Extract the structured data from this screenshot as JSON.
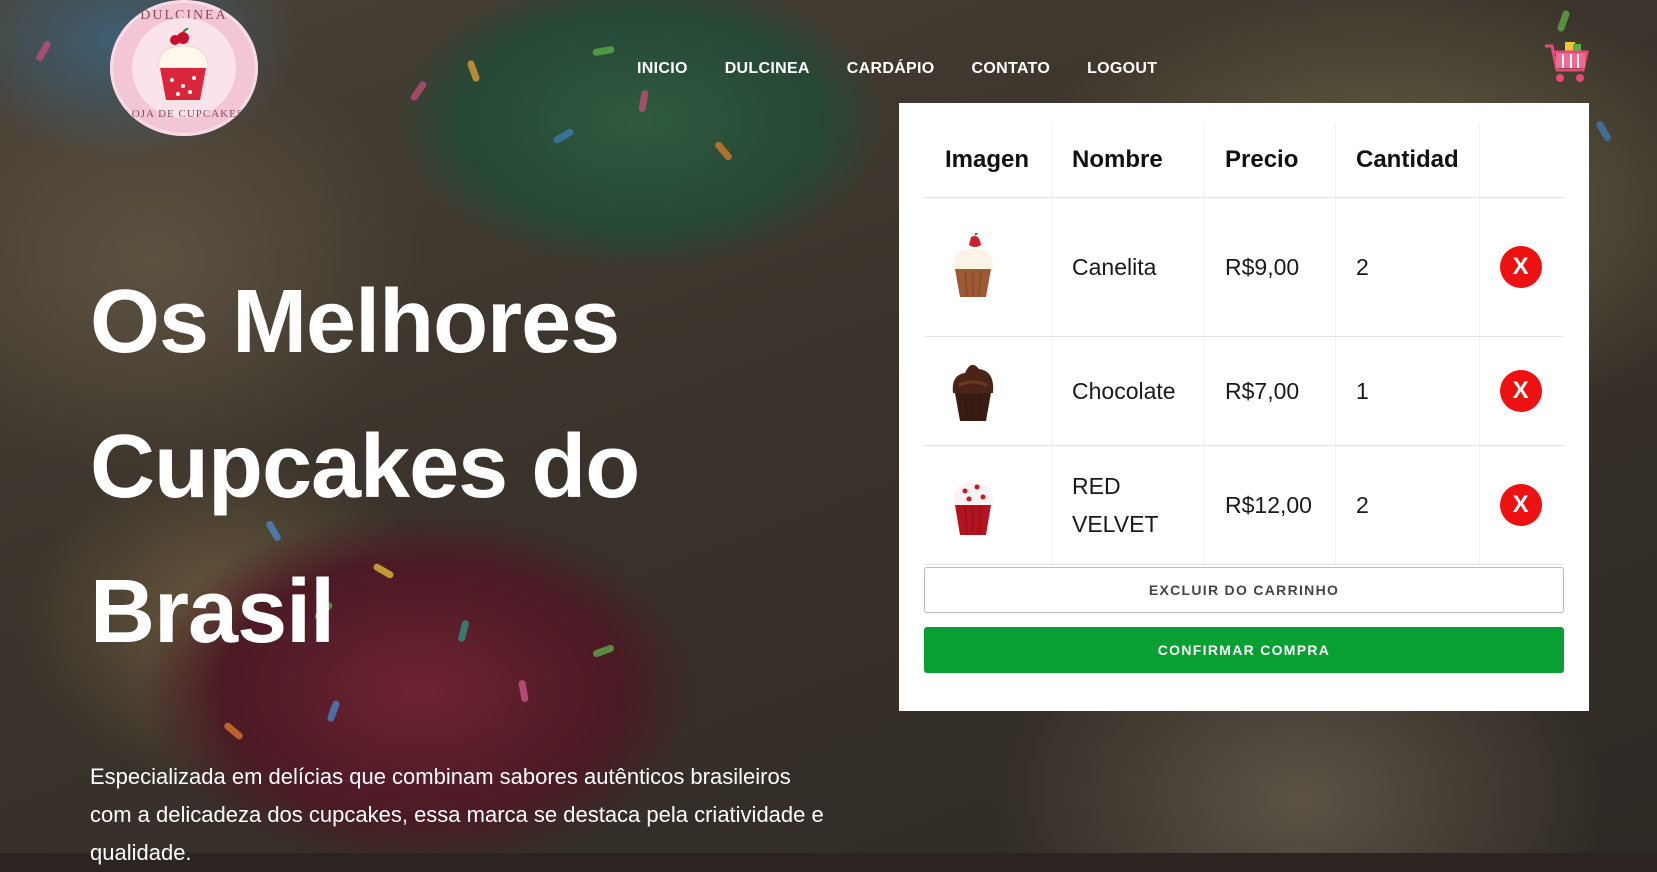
{
  "brand": {
    "logo_top_text": "DULCINEA",
    "logo_bottom_text": "LOJA DE CUPCAKES"
  },
  "nav": {
    "items": [
      {
        "label": "INICIO"
      },
      {
        "label": "DULCINEA"
      },
      {
        "label": "CARDÁPIO"
      },
      {
        "label": "CONTATO"
      },
      {
        "label": "LOGOUT"
      }
    ]
  },
  "cart_icon": "shopping-cart-icon",
  "hero": {
    "title_line1": "Os Melhores",
    "title_line2": "Cupcakes do",
    "title_line3": "Brasil",
    "description": "Especializada em delícias que combinam sabores autênticos brasileiros com a delicadeza dos cupcakes, essa marca se destaca pela criatividade e qualidade."
  },
  "cart": {
    "headers": [
      "Imagen",
      "Nombre",
      "Precio",
      "Cantidad",
      ""
    ],
    "items": [
      {
        "name": "Canelita",
        "price": "R$9,00",
        "quantity": "2",
        "remove": "X",
        "image": "strawberry-cupcake"
      },
      {
        "name": "Chocolate",
        "price": "R$7,00",
        "quantity": "1",
        "remove": "X",
        "image": "chocolate-cupcake"
      },
      {
        "name": "RED VELVET",
        "price": "R$12,00",
        "quantity": "2",
        "remove": "X",
        "image": "red-velvet-cupcake"
      }
    ],
    "clear_label": "EXCLUIR DO CARRINHO",
    "confirm_label": "CONFIRMAR COMPRA"
  },
  "colors": {
    "confirm_green": "#08a033",
    "remove_red": "#ee1111",
    "logo_pink": "#f3c6d6"
  }
}
